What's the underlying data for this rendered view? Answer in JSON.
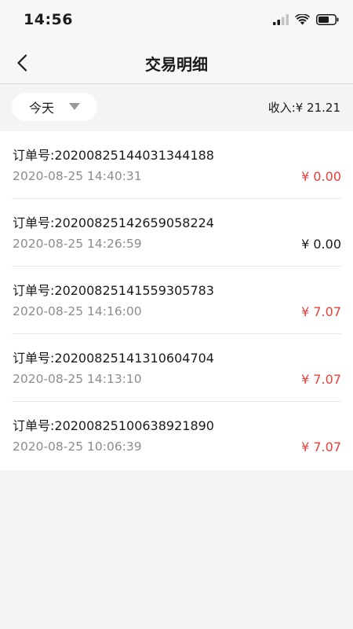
{
  "status_bar": {
    "time": "14:56",
    "icons": [
      "cellular-signal-icon",
      "wifi-icon",
      "battery-icon"
    ]
  },
  "nav": {
    "title": "交易明细",
    "back_icon": "chevron-left-icon"
  },
  "filter": {
    "selected": "今天",
    "income_label": "收入:",
    "income_value": "¥ 21.21",
    "income_text": "收入:¥ 21.21"
  },
  "colors": {
    "accent_red": "#e8403c",
    "text_primary": "#1a1a1a",
    "text_secondary": "#8c8c8c",
    "background": "#f4f4f4"
  },
  "orders": [
    {
      "order_no": "订单号:20200825144031344188",
      "time": "2020-08-25 14:40:31",
      "amount": "¥ 0.00",
      "amount_color": "red"
    },
    {
      "order_no": "订单号:20200825142659058224",
      "time": "2020-08-25 14:26:59",
      "amount": "¥ 0.00",
      "amount_color": "black"
    },
    {
      "order_no": "订单号:20200825141559305783",
      "time": "2020-08-25 14:16:00",
      "amount": "¥ 7.07",
      "amount_color": "red"
    },
    {
      "order_no": "订单号:20200825141310604704",
      "time": "2020-08-25 14:13:10",
      "amount": "¥ 7.07",
      "amount_color": "red"
    },
    {
      "order_no": "订单号:20200825100638921890",
      "time": "2020-08-25 10:06:39",
      "amount": "¥ 7.07",
      "amount_color": "red"
    }
  ]
}
